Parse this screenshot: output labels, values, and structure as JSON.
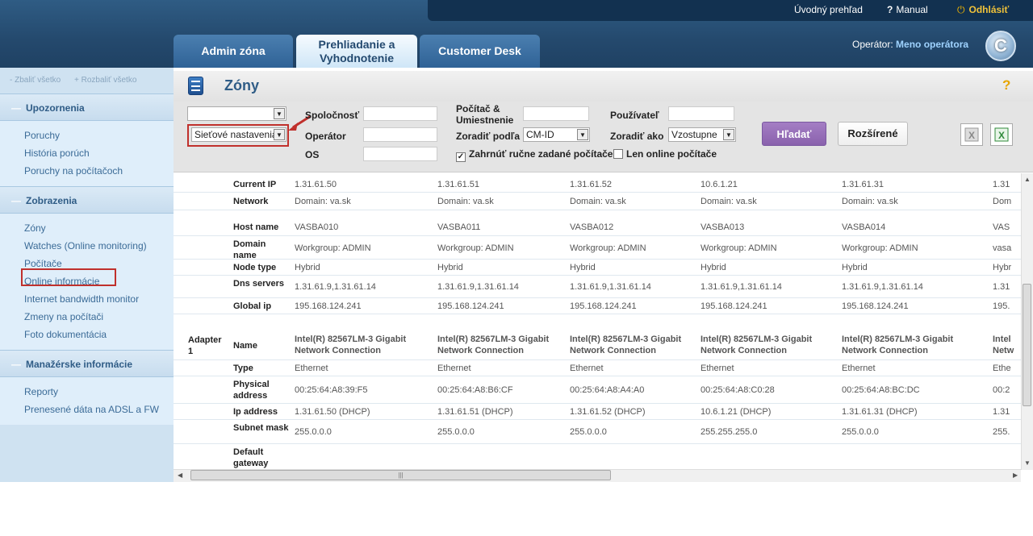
{
  "header": {
    "links": [
      "Úvodný prehľad",
      "Manual",
      "Odhlásiť"
    ],
    "tabs": [
      "Admin zóna",
      "Prehliadanie a Vyhodnotenie",
      "Customer Desk"
    ],
    "operator_label": "Operátor:",
    "operator_value": "Meno operátora",
    "logo_letter": "C"
  },
  "sidebar": {
    "collapse_all": "- Zbaliť všetko",
    "expand_all": "+ Rozbaliť všetko",
    "sections": [
      {
        "title": "Upozornenia",
        "items": [
          "Poruchy",
          "História porúch",
          "Poruchy na počítačoch"
        ]
      },
      {
        "title": "Zobrazenia",
        "items": [
          "Zóny",
          "Watches (Online monitoring)",
          "Počítače",
          "Online informácie",
          "Internet bandwidth monitor",
          "Zmeny na počítači",
          "Foto dokumentácia"
        ]
      },
      {
        "title": "Manažérske informácie",
        "items": [
          "Reporty",
          "Prenesené dáta na ADSL a FW"
        ]
      }
    ]
  },
  "page": {
    "title": "Zóny",
    "help": "?"
  },
  "filters": {
    "select1_value": "",
    "select2_value": "Sieťové nastavenia",
    "company_label": "Spoločnosť",
    "operator_label": "Operátor",
    "os_label": "OS",
    "computer_label": "Počítač & Umiestnenie",
    "sort_by_label": "Zoradiť podľa",
    "sort_by_value": "CM-ID",
    "user_label": "Používateľ",
    "sort_as_label": "Zoradiť ako",
    "sort_as_value": "Vzostupne",
    "manual_pc_label": "Zahrnúť ručne zadané počítače",
    "online_only_label": "Len online počítače",
    "search_button": "Hľadať",
    "advanced_button": "Rozšírené"
  },
  "table": {
    "rows": [
      {
        "group": "",
        "label": "Current IP",
        "values": [
          "1.31.61.50",
          "1.31.61.51",
          "1.31.61.52",
          "10.6.1.21",
          "1.31.61.31",
          "1.31"
        ]
      },
      {
        "group": "",
        "label": "Network",
        "values": [
          "Domain: va.sk",
          "Domain: va.sk",
          "Domain: va.sk",
          "Domain: va.sk",
          "Domain: va.sk",
          "Dom"
        ]
      },
      {
        "group": "",
        "label": "",
        "values": [
          "",
          "",
          "",
          "",
          "",
          ""
        ]
      },
      {
        "group": "",
        "label": "Host name",
        "values": [
          "VASBA010",
          "VASBA011",
          "VASBA012",
          "VASBA013",
          "VASBA014",
          "VAS"
        ]
      },
      {
        "group": "",
        "label": "Domain name",
        "values": [
          "Workgroup: ADMIN",
          "Workgroup: ADMIN",
          "Workgroup: ADMIN",
          "Workgroup: ADMIN",
          "Workgroup: ADMIN",
          "vasa"
        ]
      },
      {
        "group": "",
        "label": "Node type",
        "values": [
          "Hybrid",
          "Hybrid",
          "Hybrid",
          "Hybrid",
          "Hybrid",
          "Hybr"
        ]
      },
      {
        "group": "",
        "label": "Dns servers",
        "values": [
          "1.31.61.9,1.31.61.14",
          "1.31.61.9,1.31.61.14",
          "1.31.61.9,1.31.61.14",
          "1.31.61.9,1.31.61.14",
          "1.31.61.9,1.31.61.14",
          "1.31"
        ]
      },
      {
        "group": "",
        "label": "Global ip",
        "values": [
          "195.168.124.241",
          "195.168.124.241",
          "195.168.124.241",
          "195.168.124.241",
          "195.168.124.241",
          "195."
        ]
      },
      {
        "group": "",
        "label": "",
        "values": [
          "",
          "",
          "",
          "",
          "",
          ""
        ]
      },
      {
        "group": "Adapter 1",
        "label": "Name",
        "values": [
          "Intel(R) 82567LM-3 Gigabit Network Connection",
          "Intel(R) 82567LM-3 Gigabit Network Connection",
          "Intel(R) 82567LM-3 Gigabit Network Connection",
          "Intel(R) 82567LM-3 Gigabit Network Connection",
          "Intel(R) 82567LM-3 Gigabit Network Connection",
          "Intel Netw"
        ]
      },
      {
        "group": "",
        "label": "Type",
        "values": [
          "Ethernet",
          "Ethernet",
          "Ethernet",
          "Ethernet",
          "Ethernet",
          "Ethe"
        ]
      },
      {
        "group": "",
        "label": "Physical address",
        "values": [
          "00:25:64:A8:39:F5",
          "00:25:64:A8:B6:CF",
          "00:25:64:A8:A4:A0",
          "00:25:64:A8:C0:28",
          "00:25:64:A8:BC:DC",
          "00:2"
        ]
      },
      {
        "group": "",
        "label": "Ip address",
        "values": [
          "1.31.61.50 (DHCP)",
          "1.31.61.51 (DHCP)",
          "1.31.61.52 (DHCP)",
          "10.6.1.21 (DHCP)",
          "1.31.61.31 (DHCP)",
          "1.31"
        ]
      },
      {
        "group": "",
        "label": "Subnet mask",
        "values": [
          "255.0.0.0",
          "255.0.0.0",
          "255.0.0.0",
          "255.255.255.0",
          "255.0.0.0",
          "255."
        ]
      },
      {
        "group": "",
        "label": "Default gateway",
        "values": [
          "",
          "",
          "",
          "",
          "",
          ""
        ]
      }
    ]
  },
  "colors": {
    "header_bg": "#24496d",
    "sidebar_bg": "#cfe2f1",
    "accent": "#2f5c86",
    "search_button": "#8a62ad",
    "highlight_box": "#c0302c"
  }
}
